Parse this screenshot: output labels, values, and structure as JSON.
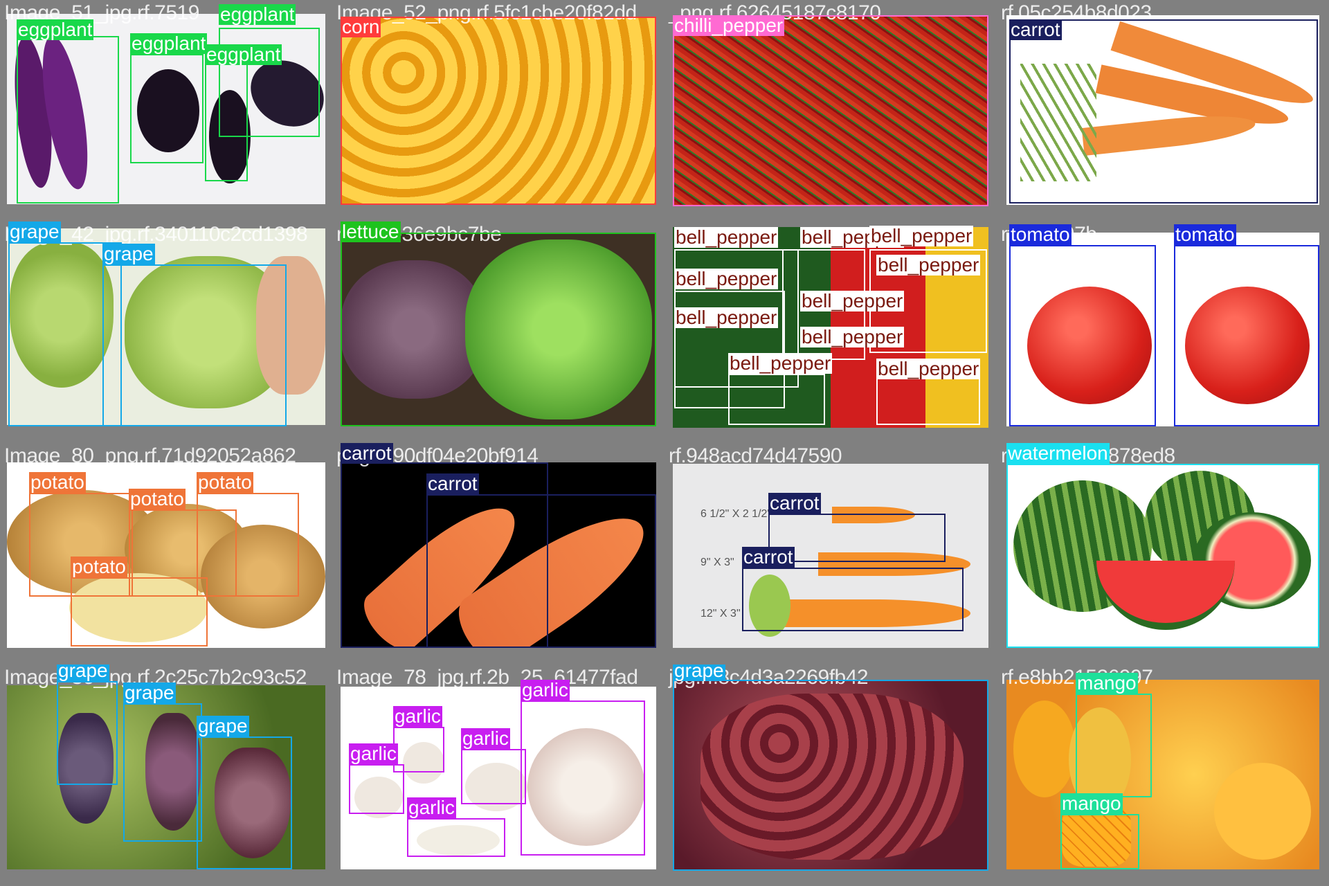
{
  "cells": [
    {
      "id": "c0",
      "filename": "Image_51_jpg.rf.7519",
      "bg": "#f2f2f4",
      "motif": "eggplant",
      "boxes": [
        {
          "label": "eggplant",
          "color": "#19d84a",
          "text_color": "#ffffff"
        },
        {
          "label": "eggplant",
          "color": "#19d84a",
          "text_color": "#ffffff"
        },
        {
          "label": "eggplant",
          "color": "#19d84a",
          "text_color": "#ffffff"
        },
        {
          "label": "eggplant",
          "color": "#19d84a",
          "text_color": "#ffffff"
        }
      ]
    },
    {
      "id": "c1",
      "filename": "Image_52_png.rf.5fc1cbe20f82dd",
      "bg": "#f0a418",
      "motif": "corn",
      "boxes": [
        {
          "label": "corn",
          "color": "#ff3b3b",
          "text_color": "#ffffff"
        }
      ]
    },
    {
      "id": "c2",
      "filename": "_png.rf.62645187c8170",
      "bg": "#b3281e",
      "motif": "chilli",
      "boxes": [
        {
          "label": "chilli_pepper",
          "color": "#ff6ad2",
          "text_color": "#ffffff"
        }
      ]
    },
    {
      "id": "c3",
      "filename": "rf.05c254b8d023",
      "bg": "#ffffff",
      "motif": "carrot-white",
      "boxes": [
        {
          "label": "carrot",
          "color": "#1a1f5e",
          "text_color": "#ffffff"
        }
      ]
    },
    {
      "id": "c4",
      "filename": "Image_42_jpg.rf.340110c2cd1398",
      "bg": "#d9e2c4",
      "motif": "grape-green",
      "boxes": [
        {
          "label": "grape",
          "color": "#14a8e8",
          "text_color": "#ffffff"
        },
        {
          "label": "grape",
          "color": "#14a8e8",
          "text_color": "#ffffff"
        }
      ]
    },
    {
      "id": "c5",
      "filename": "rf.fcc2e36e9bc7be",
      "bg": "#4a3a2a",
      "motif": "lettuce",
      "boxes": [
        {
          "label": "lettuce",
          "color": "#1ec31e",
          "text_color": "#ffffff"
        }
      ]
    },
    {
      "id": "c6",
      "filename": "",
      "bg": "#1e1e1e",
      "motif": "bellpepper",
      "boxes": [
        {
          "label": "bell_pepper",
          "color": "#ffffff",
          "text_color": "#7a1a10"
        },
        {
          "label": "bell_pepper",
          "color": "#ffffff",
          "text_color": "#7a1a10"
        },
        {
          "label": "bell_pepper",
          "color": "#ffffff",
          "text_color": "#7a1a10"
        },
        {
          "label": "bell_pepper",
          "color": "#ffffff",
          "text_color": "#7a1a10"
        },
        {
          "label": "bell_pepper",
          "color": "#ffffff",
          "text_color": "#7a1a10"
        },
        {
          "label": "bell_pepper",
          "color": "#ffffff",
          "text_color": "#7a1a10"
        },
        {
          "label": "bell_pepper",
          "color": "#ffffff",
          "text_color": "#7a1a10"
        },
        {
          "label": "bell_pepper",
          "color": "#ffffff",
          "text_color": "#7a1a10"
        },
        {
          "label": "bell_pepper",
          "color": "#ffffff",
          "text_color": "#7a1a10"
        },
        {
          "label": "bell_pepper",
          "color": "#ffffff",
          "text_color": "#7a1a10"
        }
      ]
    },
    {
      "id": "c7",
      "filename": "rf.1ed997b",
      "bg": "#ffffff",
      "motif": "tomato",
      "boxes": [
        {
          "label": "tomato",
          "color": "#1a2adc",
          "text_color": "#ffffff"
        },
        {
          "label": "tomato",
          "color": "#1a2adc",
          "text_color": "#ffffff"
        }
      ]
    },
    {
      "id": "c8",
      "filename": "Image_80_png.rf.71d92052a862",
      "bg": "#ffffff",
      "motif": "potato",
      "boxes": [
        {
          "label": "potato",
          "color": "#ef7438",
          "text_color": "#ffffff"
        },
        {
          "label": "potato",
          "color": "#ef7438",
          "text_color": "#ffffff"
        },
        {
          "label": "potato",
          "color": "#ef7438",
          "text_color": "#ffffff"
        },
        {
          "label": "potato",
          "color": "#ef7438",
          "text_color": "#ffffff"
        }
      ]
    },
    {
      "id": "c9",
      "filename": "png.rf.90df04e20bf914",
      "bg": "#000000",
      "motif": "carrot-black",
      "boxes": [
        {
          "label": "carrot",
          "color": "#1a1f5e",
          "text_color": "#ffffff"
        },
        {
          "label": "carrot",
          "color": "#1a1f5e",
          "text_color": "#ffffff"
        }
      ]
    },
    {
      "id": "c10",
      "filename": "rf.948acd74d47590",
      "bg": "#e9e9ea",
      "motif": "carrot-toy",
      "dims": [
        "6 1/2\" X 2 1/2\"",
        "9\" X 3\"",
        "12\" X 3\""
      ],
      "boxes": [
        {
          "label": "carrot",
          "color": "#1a1f5e",
          "text_color": "#ffffff"
        },
        {
          "label": "carrot",
          "color": "#1a1f5e",
          "text_color": "#ffffff"
        }
      ]
    },
    {
      "id": "c11",
      "filename": "rf.43697127878ed8",
      "bg": "#ffffff",
      "motif": "watermelon",
      "boxes": [
        {
          "label": "watermelon",
          "color": "#1ae0f0",
          "text_color": "#ffffff"
        }
      ]
    },
    {
      "id": "c12",
      "filename": "Image_36_jpg.rf.2c25c7b2c93c52",
      "bg": "#6b8a36",
      "motif": "grape-vine",
      "boxes": [
        {
          "label": "grape",
          "color": "#14a8e8",
          "text_color": "#ffffff"
        },
        {
          "label": "grape",
          "color": "#14a8e8",
          "text_color": "#ffffff"
        },
        {
          "label": "grape",
          "color": "#14a8e8",
          "text_color": "#ffffff"
        }
      ]
    },
    {
      "id": "c13",
      "filename": "Image_78_jpg.rf.2b_25_61477fad",
      "bg": "#ffffff",
      "motif": "garlic",
      "boxes": [
        {
          "label": "garlic",
          "color": "#c81ef0",
          "text_color": "#ffffff"
        },
        {
          "label": "garlic",
          "color": "#c81ef0",
          "text_color": "#ffffff"
        },
        {
          "label": "garlic",
          "color": "#c81ef0",
          "text_color": "#ffffff"
        },
        {
          "label": "garlic",
          "color": "#c81ef0",
          "text_color": "#ffffff"
        },
        {
          "label": "garlic",
          "color": "#c81ef0",
          "text_color": "#ffffff"
        }
      ]
    },
    {
      "id": "c14",
      "filename": "jpg.rf.8c4d3a2269fb42",
      "bg": "#7a2a3a",
      "motif": "grape-red",
      "boxes": [
        {
          "label": "grape",
          "color": "#14a8e8",
          "text_color": "#ffffff"
        }
      ]
    },
    {
      "id": "c15",
      "filename": "rf.e8bb21526997",
      "bg": "#f4b230",
      "motif": "mango",
      "boxes": [
        {
          "label": "mango",
          "color": "#1ee09a",
          "text_color": "#ffffff"
        },
        {
          "label": "mango",
          "color": "#1ee09a",
          "text_color": "#ffffff"
        }
      ]
    }
  ]
}
